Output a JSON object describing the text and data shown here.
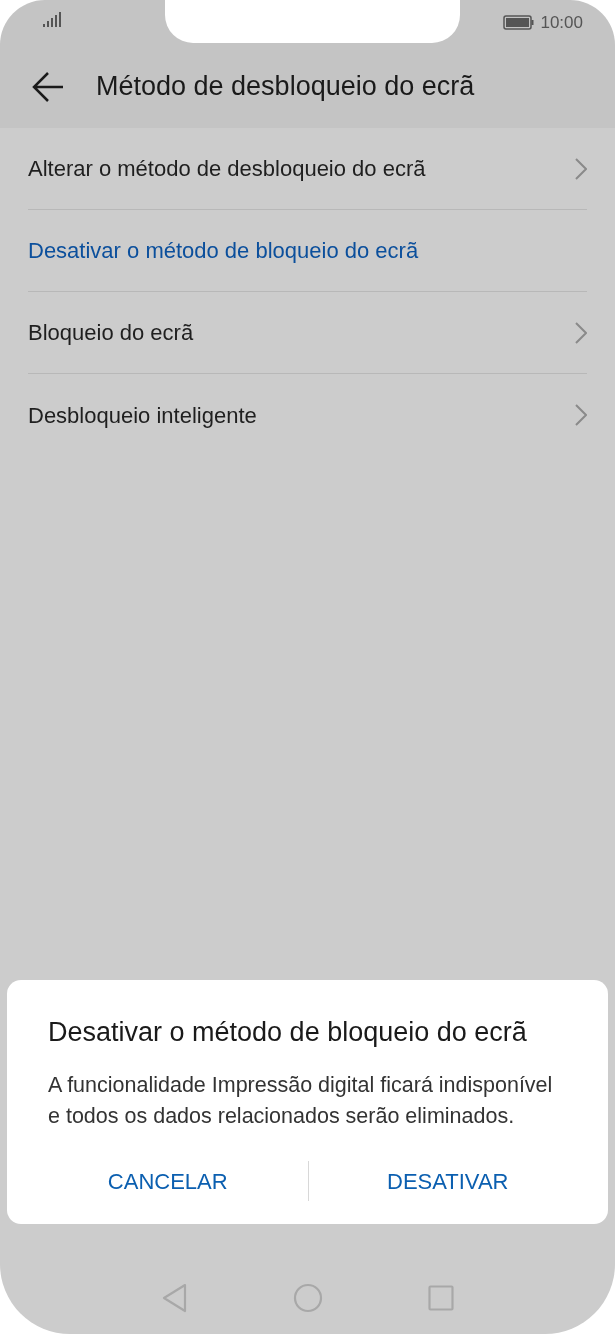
{
  "status_bar": {
    "time": "10:00"
  },
  "header": {
    "title": "Método de desbloqueio do ecrã"
  },
  "items": [
    {
      "label": "Alterar o método de desbloqueio do ecrã",
      "kind": "nav"
    },
    {
      "label": "Desativar o método de bloqueio do ecrã",
      "kind": "action"
    },
    {
      "label": "Bloqueio do ecrã",
      "kind": "nav"
    },
    {
      "label": "Desbloqueio inteligente",
      "kind": "nav"
    }
  ],
  "dialog": {
    "title": "Desativar o método de bloqueio do ecrã",
    "message": "A funcionalidade Impressão digital ficará indisponível e todos os dados relacionados serão eliminados.",
    "buttons": [
      "CANCELAR",
      "DESATIVAR"
    ]
  }
}
